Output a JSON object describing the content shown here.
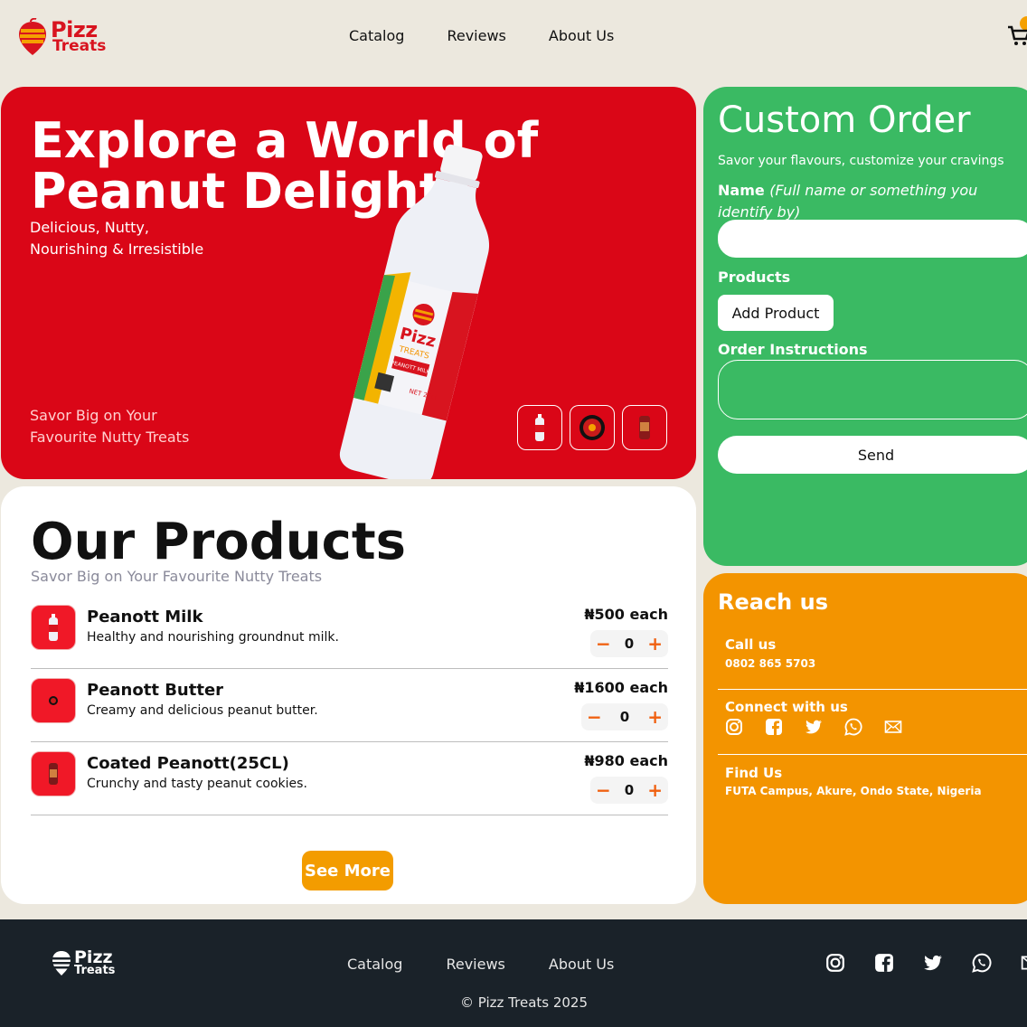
{
  "brand": {
    "name_line1": "Pizz",
    "name_line2": "Treats"
  },
  "nav": {
    "catalog": "Catalog",
    "reviews": "Reviews",
    "about": "About Us"
  },
  "hero": {
    "title": "Explore a World of Peanut Delights",
    "subtitle_line1": "Delicious, Nutty,",
    "subtitle_line2": "Nourishing & Irresistible",
    "savor_line1": "Savor Big on Your",
    "savor_line2": "Favourite Nutty Treats",
    "bottle_label": {
      "brand": "Pizz",
      "sub": "TREATS",
      "tag": "PEANOTT MILK",
      "net": "NET 25cl"
    }
  },
  "products": {
    "title": "Our Products",
    "subtitle": "Savor Big on Your Favourite Nutty Treats",
    "items": [
      {
        "name": "Peanott Milk",
        "desc": "Healthy and nourishing groundnut milk.",
        "price": "₦500 each",
        "qty": "0",
        "minus": "−",
        "plus": "+"
      },
      {
        "name": "Peanott Butter",
        "desc": "Creamy and delicious peanut butter.",
        "price": "₦1600 each",
        "qty": "0",
        "minus": "−",
        "plus": "+"
      },
      {
        "name": "Coated Peanott(25CL)",
        "desc": "Crunchy and tasty peanut cookies.",
        "price": "₦980 each",
        "qty": "0",
        "minus": "−",
        "plus": "+"
      }
    ],
    "see_more": "See More"
  },
  "custom_order": {
    "title": "Custom Order",
    "subtitle": "Savor your flavours, customize your cravings",
    "name_label": "Name",
    "name_hint": "(Full name or something you identify by)",
    "products_label": "Products",
    "add_product": "Add Product",
    "instructions_label": "Order Instructions",
    "send": "Send"
  },
  "reach": {
    "title": "Reach us",
    "call_title": "Call us",
    "call_value": "0802 865 5703",
    "connect_title": "Connect with us",
    "find_title": "Find Us",
    "find_value": "FUTA Campus, Akure, Ondo State, Nigeria"
  },
  "footer": {
    "copyright": "© Pizz Treats 2025"
  },
  "colors": {
    "hero_red": "#da0617",
    "custom_green": "#3aba63",
    "reach_orange": "#f39400",
    "accent_orange": "#f39c00",
    "footer_bg": "#1a2229"
  },
  "icons": [
    "cart-icon",
    "instagram-icon",
    "facebook-icon",
    "twitter-icon",
    "whatsapp-icon",
    "mail-icon"
  ]
}
